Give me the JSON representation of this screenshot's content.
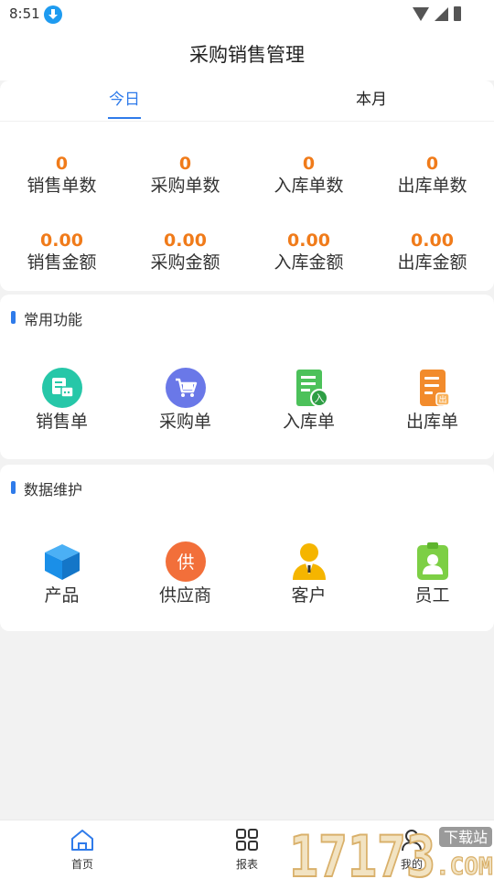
{
  "status_bar": {
    "time": "8:51"
  },
  "header": {
    "title": "采购销售管理"
  },
  "tabs": [
    {
      "label": "今日"
    },
    {
      "label": "本月"
    }
  ],
  "stats": [
    {
      "value": "0",
      "label": "销售单数"
    },
    {
      "value": "0",
      "label": "采购单数"
    },
    {
      "value": "0",
      "label": "入库单数"
    },
    {
      "value": "0",
      "label": "出库单数"
    },
    {
      "value": "0.00",
      "label": "销售金额"
    },
    {
      "value": "0.00",
      "label": "采购金额"
    },
    {
      "value": "0.00",
      "label": "入库金额"
    },
    {
      "value": "0.00",
      "label": "出库金额"
    }
  ],
  "common": {
    "title": "常用功能",
    "items": [
      {
        "label": "销售单",
        "icon": "sales-order-icon",
        "color": "#26c7a8"
      },
      {
        "label": "采购单",
        "icon": "cart-icon",
        "color": "#6a78e8"
      },
      {
        "label": "入库单",
        "icon": "inbound-doc-icon",
        "color": "#4cc15a",
        "badge": "入"
      },
      {
        "label": "出库单",
        "icon": "outbound-doc-icon",
        "color": "#f28b2c",
        "badge": "出"
      }
    ]
  },
  "maintenance": {
    "title": "数据维护",
    "items": [
      {
        "label": "产品",
        "icon": "box-icon",
        "color": "#1a8fe8"
      },
      {
        "label": "供应商",
        "icon": "supplier-icon",
        "color": "#f26f3a",
        "badge": "供"
      },
      {
        "label": "客户",
        "icon": "customer-icon",
        "color": "#f5b500"
      },
      {
        "label": "员工",
        "icon": "badge-icon",
        "color": "#7dcf45"
      }
    ]
  },
  "bottom_nav": [
    {
      "label": "首页",
      "icon": "home-icon"
    },
    {
      "label": "报表",
      "icon": "grid-icon"
    },
    {
      "label": "我的",
      "icon": "user-icon"
    }
  ],
  "watermark": {
    "text": "17173",
    "sub": "下载站",
    "dot": ".COM"
  },
  "colors": {
    "accent": "#2f7bea",
    "stat_value": "#f07b1a"
  }
}
